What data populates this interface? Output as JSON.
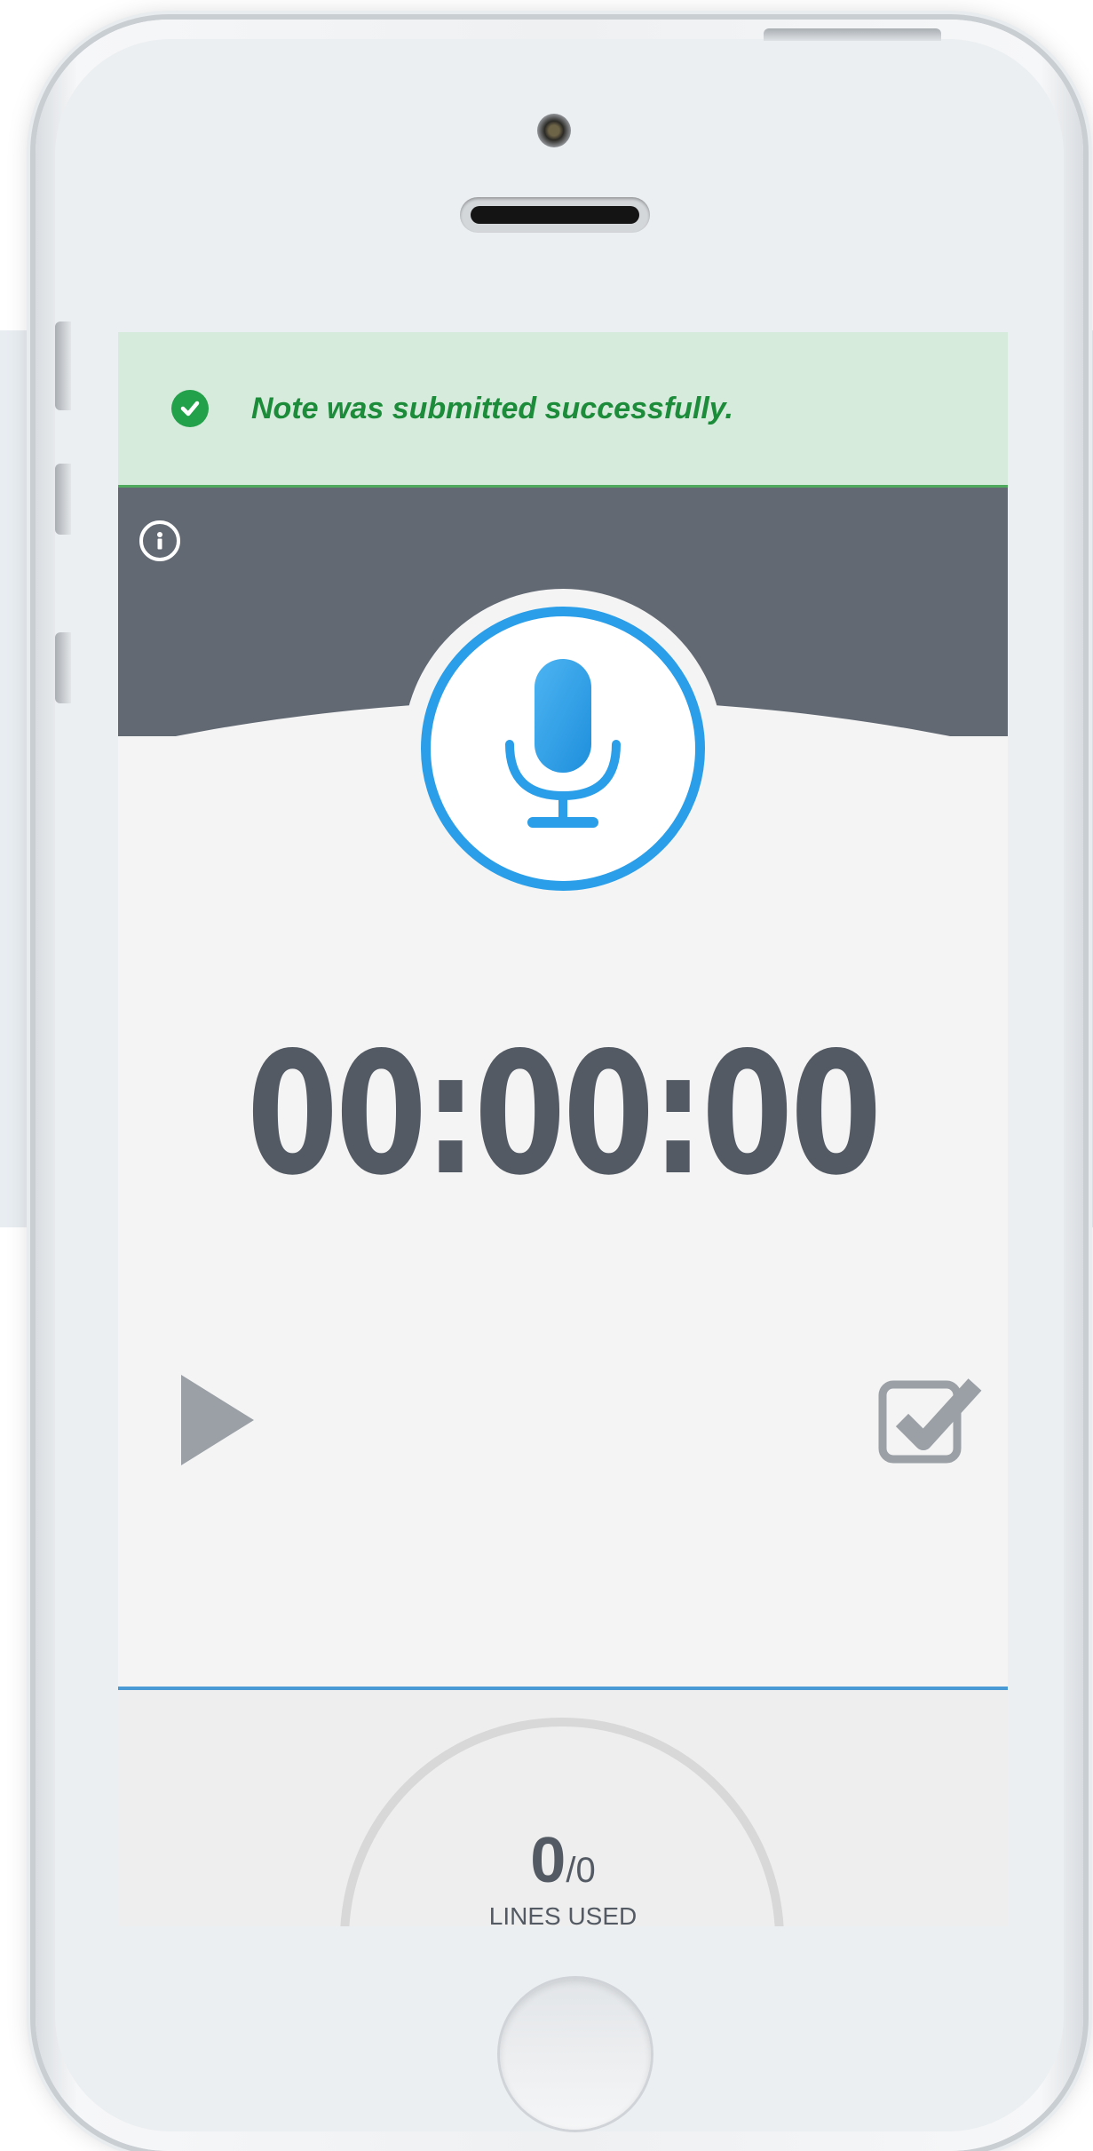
{
  "notification": {
    "message": "Note was submitted successfully.",
    "icon": "check-circle-icon",
    "color": "#23a04a"
  },
  "header": {
    "info_icon": "info-icon",
    "color": "#626973"
  },
  "recorder": {
    "mic_icon": "microphone-icon",
    "accent_color": "#2a9ee8",
    "timer": "00:00:00"
  },
  "controls": {
    "play_icon": "play-icon",
    "submit_icon": "checkbox-check-icon"
  },
  "usage": {
    "used": "0",
    "total": "/0",
    "label": "LINES USED"
  }
}
